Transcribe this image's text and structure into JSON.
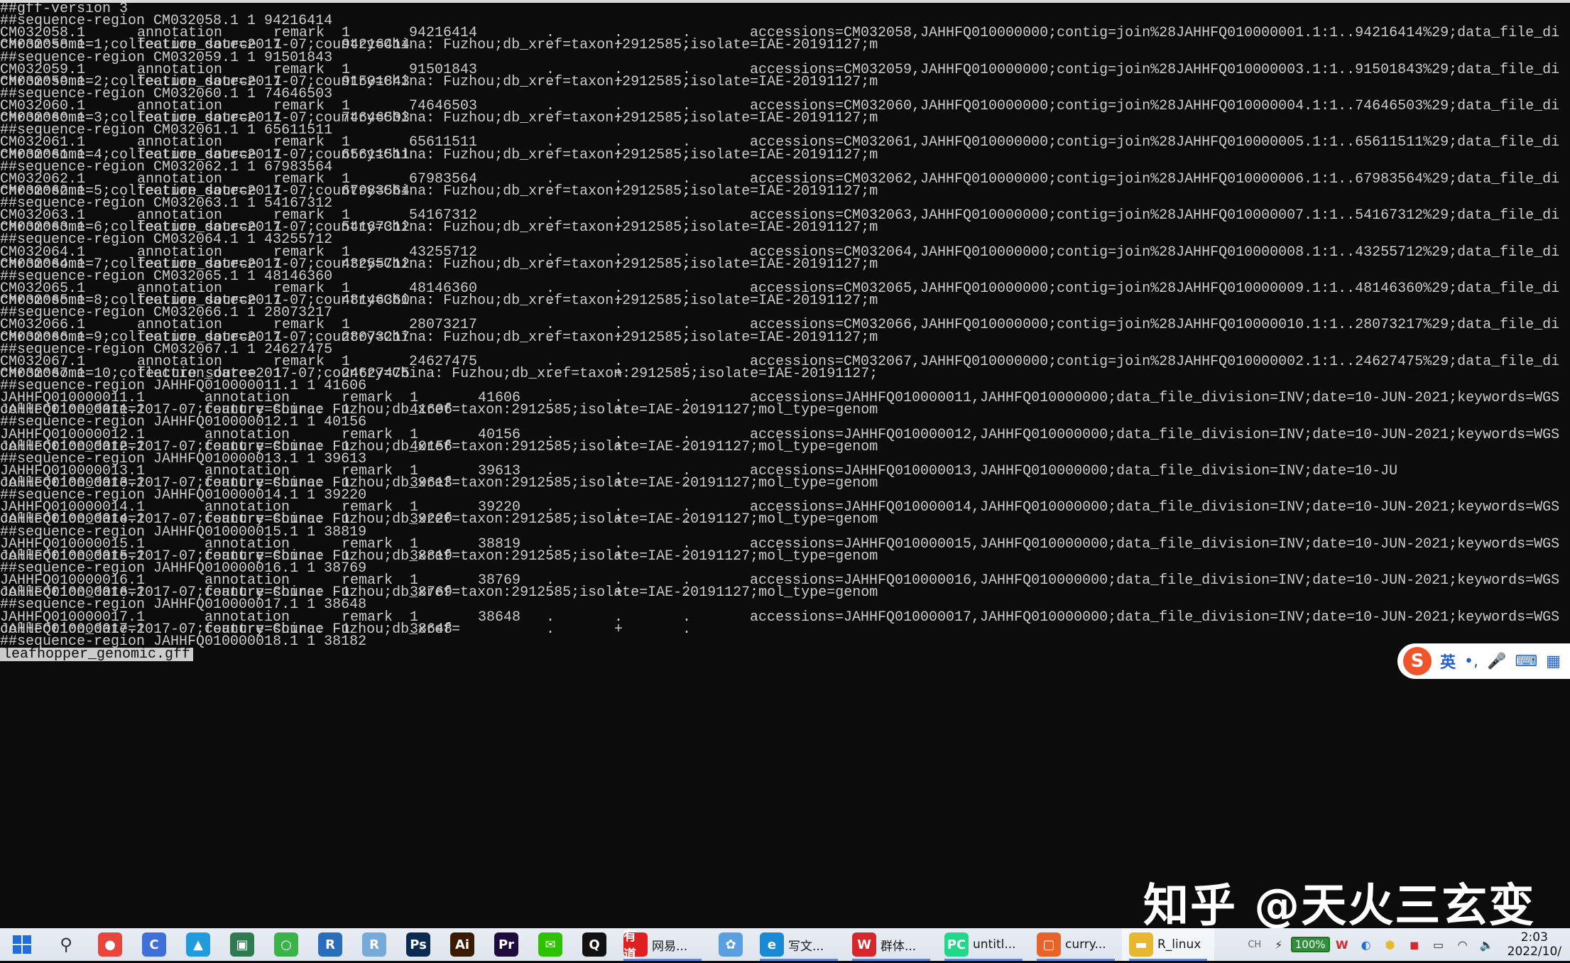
{
  "terminal": {
    "lines": [
      [
        "##gff-version 3"
      ],
      [
        "##sequence-region CM032058.1 1 94216414"
      ],
      [
        "CM032058.1",
        "annotation",
        "remark",
        "1",
        "94216414",
        ".",
        ".",
        ".",
        "accessions=CM032058,JAHHFQ010000000;contig=join%28JAHHFQ010000001.1:1..94216414%29;data_file_di"
      ],
      [
        "CM032058.1",
        "feature source",
        "1",
        "94216414",
        ".",
        "+",
        ".",
        "chromosome=1;collection_date=2017-07;country=China: Fuzhou;db_xref=taxon:2912585;isolate=IAE-20191127;m"
      ],
      [
        "##sequence-region CM032059.1 1 91501843"
      ],
      [
        "CM032059.1",
        "annotation",
        "remark",
        "1",
        "91501843",
        ".",
        ".",
        ".",
        "accessions=CM032059,JAHHFQ010000000;contig=join%28JAHHFQ010000003.1:1..91501843%29;data_file_di"
      ],
      [
        "CM032059.1",
        "feature source",
        "1",
        "91501843",
        ".",
        "+",
        ".",
        "chromosome=2;collection_date=2017-07;country=China: Fuzhou;db_xref=taxon:2912585;isolate=IAE-20191127;m"
      ],
      [
        "##sequence-region CM032060.1 1 74646503"
      ],
      [
        "CM032060.1",
        "annotation",
        "remark",
        "1",
        "74646503",
        ".",
        ".",
        ".",
        "accessions=CM032060,JAHHFQ010000000;contig=join%28JAHHFQ010000004.1:1..74646503%29;data_file_di"
      ],
      [
        "CM032060.1",
        "feature source",
        "1",
        "74646503",
        ".",
        "+",
        ".",
        "chromosome=3;collection_date=2017-07;country=China: Fuzhou;db_xref=taxon:2912585;isolate=IAE-20191127;m"
      ],
      [
        "##sequence-region CM032061.1 1 65611511"
      ],
      [
        "CM032061.1",
        "annotation",
        "remark",
        "1",
        "65611511",
        ".",
        ".",
        ".",
        "accessions=CM032061,JAHHFQ010000000;contig=join%28JAHHFQ010000005.1:1..65611511%29;data_file_di"
      ],
      [
        "CM032061.1",
        "feature source",
        "1",
        "65611511",
        ".",
        "+",
        ".",
        "chromosome=4;collection_date=2017-07;country=China: Fuzhou;db_xref=taxon:2912585;isolate=IAE-20191127;m"
      ],
      [
        "##sequence-region CM032062.1 1 67983564"
      ],
      [
        "CM032062.1",
        "annotation",
        "remark",
        "1",
        "67983564",
        ".",
        ".",
        ".",
        "accessions=CM032062,JAHHFQ010000000;contig=join%28JAHHFQ010000006.1:1..67983564%29;data_file_di"
      ],
      [
        "CM032062.1",
        "feature source",
        "1",
        "67983564",
        ".",
        "+",
        ".",
        "chromosome=5;collection_date=2017-07;country=China: Fuzhou;db_xref=taxon:2912585;isolate=IAE-20191127;m"
      ],
      [
        "##sequence-region CM032063.1 1 54167312"
      ],
      [
        "CM032063.1",
        "annotation",
        "remark",
        "1",
        "54167312",
        ".",
        ".",
        ".",
        "accessions=CM032063,JAHHFQ010000000;contig=join%28JAHHFQ010000007.1:1..54167312%29;data_file_di"
      ],
      [
        "CM032063.1",
        "feature source",
        "1",
        "54167312",
        ".",
        "+",
        ".",
        "chromosome=6;collection_date=2017-07;country=China: Fuzhou;db_xref=taxon:2912585;isolate=IAE-20191127;m"
      ],
      [
        "##sequence-region CM032064.1 1 43255712"
      ],
      [
        "CM032064.1",
        "annotation",
        "remark",
        "1",
        "43255712",
        ".",
        ".",
        ".",
        "accessions=CM032064,JAHHFQ010000000;contig=join%28JAHHFQ010000008.1:1..43255712%29;data_file_di"
      ],
      [
        "CM032064.1",
        "feature source",
        "1",
        "43255712",
        ".",
        "+",
        ".",
        "chromosome=7;collection_date=2017-07;country=China: Fuzhou;db_xref=taxon:2912585;isolate=IAE-20191127;m"
      ],
      [
        "##sequence-region CM032065.1 1 48146360"
      ],
      [
        "CM032065.1",
        "annotation",
        "remark",
        "1",
        "48146360",
        ".",
        ".",
        ".",
        "accessions=CM032065,JAHHFQ010000000;contig=join%28JAHHFQ010000009.1:1..48146360%29;data_file_di"
      ],
      [
        "CM032065.1",
        "feature source",
        "1",
        "48146360",
        ".",
        "+",
        ".",
        "chromosome=8;collection_date=2017-07;country=China: Fuzhou;db_xref=taxon:2912585;isolate=IAE-20191127;m"
      ],
      [
        "##sequence-region CM032066.1 1 28073217"
      ],
      [
        "CM032066.1",
        "annotation",
        "remark",
        "1",
        "28073217",
        ".",
        ".",
        ".",
        "accessions=CM032066,JAHHFQ010000000;contig=join%28JAHHFQ010000010.1:1..28073217%29;data_file_di"
      ],
      [
        "CM032066.1",
        "feature source",
        "1",
        "28073217",
        ".",
        "+",
        ".",
        "chromosome=9;collection_date=2017-07;country=China: Fuzhou;db_xref=taxon:2912585;isolate=IAE-20191127;m"
      ],
      [
        "##sequence-region CM032067.1 1 24627475"
      ],
      [
        "CM032067.1",
        "annotation",
        "remark",
        "1",
        "24627475",
        ".",
        ".",
        ".",
        "accessions=CM032067,JAHHFQ010000000;contig=join%28JAHHFQ010000002.1:1..24627475%29;data_file_di"
      ],
      [
        "CM032067.1",
        "feature source",
        "1",
        "24627475",
        ".",
        "+",
        ".",
        "chromosome=10;collection_date=2017-07;country=China: Fuzhou;db_xref=taxon:2912585;isolate=IAE-20191127;"
      ],
      [
        "##sequence-region JAHHFQ010000011.1 1 41606"
      ],
      [
        "JAHHFQ010000011.1",
        "annotation",
        "remark",
        "1",
        "41606",
        ".",
        ".",
        ".",
        "accessions=JAHHFQ010000011,JAHHFQ010000000;data_file_division=INV;date=10-JUN-2021;keywords=WGS"
      ],
      [
        "JAHHFQ010000011.1",
        "feature source",
        "1",
        "41606",
        ".",
        "+",
        ".",
        "collection_date=2017-07;country=China: Fuzhou;db_xref=taxon:2912585;isolate=IAE-20191127;mol_type=genom"
      ],
      [
        "##sequence-region JAHHFQ010000012.1 1 40156"
      ],
      [
        "JAHHFQ010000012.1",
        "annotation",
        "remark",
        "1",
        "40156",
        ".",
        ".",
        ".",
        "accessions=JAHHFQ010000012,JAHHFQ010000000;data_file_division=INV;date=10-JUN-2021;keywords=WGS"
      ],
      [
        "JAHHFQ010000012.1",
        "feature source",
        "1",
        "40156",
        ".",
        "+",
        ".",
        "collection_date=2017-07;country=China: Fuzhou;db_xref=taxon:2912585;isolate=IAE-20191127;mol_type=genom"
      ],
      [
        "##sequence-region JAHHFQ010000013.1 1 39613"
      ],
      [
        "JAHHFQ010000013.1",
        "annotation",
        "remark",
        "1",
        "39613",
        ".",
        ".",
        ".",
        "accessions=JAHHFQ010000013,JAHHFQ010000000;data_file_division=INV;date=10-JU"
      ],
      [
        "JAHHFQ010000013.1",
        "feature source",
        "1",
        "39613",
        ".",
        "+",
        ".",
        "collection_date=2017-07;country=China: Fuzhou;db_xref=taxon:2912585;isolate=IAE-20191127;mol_type=genom"
      ],
      [
        "##sequence-region JAHHFQ010000014.1 1 39220"
      ],
      [
        "JAHHFQ010000014.1",
        "annotation",
        "remark",
        "1",
        "39220",
        ".",
        ".",
        ".",
        "accessions=JAHHFQ010000014,JAHHFQ010000000;data_file_division=INV;date=10-JUN-2021;keywords=WGS"
      ],
      [
        "JAHHFQ010000014.1",
        "feature source",
        "1",
        "39220",
        ".",
        "+",
        ".",
        "collection_date=2017-07;country=China: Fuzhou;db_xref=taxon:2912585;isolate=IAE-20191127;mol_type=genom"
      ],
      [
        "##sequence-region JAHHFQ010000015.1 1 38819"
      ],
      [
        "JAHHFQ010000015.1",
        "annotation",
        "remark",
        "1",
        "38819",
        ".",
        ".",
        ".",
        "accessions=JAHHFQ010000015,JAHHFQ010000000;data_file_division=INV;date=10-JUN-2021;keywords=WGS"
      ],
      [
        "JAHHFQ010000015.1",
        "feature source",
        "1",
        "38819",
        ".",
        "+",
        ".",
        "collection_date=2017-07;country=China: Fuzhou;db_xref=taxon:2912585;isolate=IAE-20191127;mol_type=genom"
      ],
      [
        "##sequence-region JAHHFQ010000016.1 1 38769"
      ],
      [
        "JAHHFQ010000016.1",
        "annotation",
        "remark",
        "1",
        "38769",
        ".",
        ".",
        ".",
        "accessions=JAHHFQ010000016,JAHHFQ010000000;data_file_division=INV;date=10-JUN-2021;keywords=WGS"
      ],
      [
        "JAHHFQ010000016.1",
        "feature source",
        "1",
        "38769",
        ".",
        "+",
        ".",
        "collection_date=2017-07;country=China: Fuzhou;db_xref=taxon:2912585;isolate=IAE-20191127;mol_type=genom"
      ],
      [
        "##sequence-region JAHHFQ010000017.1 1 38648"
      ],
      [
        "JAHHFQ010000017.1",
        "annotation",
        "remark",
        "1",
        "38648",
        ".",
        ".",
        ".",
        "accessions=JAHHFQ010000017,JAHHFQ010000000;data_file_division=INV;date=10-JUN-2021;keywords=WGS"
      ],
      [
        "JAHHFQ010000017.1",
        "feature source",
        "1",
        "38648",
        ".",
        "+",
        ".",
        "collection_date=2017-07;country=China: Fuzhou;db_xref="
      ],
      [
        "##sequence-region JAHHFQ010000018.1 1 38182"
      ]
    ],
    "status": "leafhopper_genomic.gff"
  },
  "ime": {
    "logo": "S",
    "mode": "英",
    "punct": "•,",
    "mic": "🎤",
    "keyboard": "⌨",
    "grid": "▦"
  },
  "watermark": "知乎 @天火三玄变",
  "taskbar": {
    "items": [
      {
        "name": "windows-start-button",
        "label": "",
        "icon": "windows-logo",
        "color": "#1f6fd6"
      },
      {
        "name": "search-button",
        "label": "",
        "icon": "search-icon",
        "color": "#333333"
      },
      {
        "name": "taskbar-chrome",
        "label": "",
        "icon": "chrome-icon",
        "color": "#e8453c"
      },
      {
        "name": "taskbar-app-blue",
        "label": "",
        "icon": "circle-app-icon",
        "color": "#3f6fd8"
      },
      {
        "name": "taskbar-photos",
        "label": "",
        "icon": "photos-icon",
        "color": "#1f9bde"
      },
      {
        "name": "taskbar-app-green-window",
        "label": "",
        "icon": "window-app-icon",
        "color": "#2f7a4f"
      },
      {
        "name": "taskbar-app-green-circle",
        "label": "",
        "icon": "ring-app-icon",
        "color": "#3cb34a"
      },
      {
        "name": "taskbar-r",
        "label": "",
        "icon": "r-icon",
        "color": "#2a6ebb"
      },
      {
        "name": "taskbar-rstudio",
        "label": "",
        "icon": "rstudio-icon",
        "color": "#75aadb"
      },
      {
        "name": "taskbar-photoshop",
        "label": "",
        "icon": "photoshop-icon",
        "color": "#0b2a52"
      },
      {
        "name": "taskbar-illustrator",
        "label": "",
        "icon": "illustrator-icon",
        "color": "#3a1b00"
      },
      {
        "name": "taskbar-premiere",
        "label": "",
        "icon": "premiere-icon",
        "color": "#1e0a3c"
      },
      {
        "name": "taskbar-wechat",
        "label": "",
        "icon": "wechat-icon",
        "color": "#2dc100"
      },
      {
        "name": "taskbar-qq",
        "label": "",
        "icon": "qq-icon",
        "color": "#111111"
      },
      {
        "name": "taskbar-youdao",
        "label": "网易...",
        "icon": "youdao-icon",
        "color": "#e02020"
      },
      {
        "name": "taskbar-app-fan",
        "label": "",
        "icon": "fan-app-icon",
        "color": "#5aa0e0"
      },
      {
        "name": "taskbar-edge",
        "label": "写文...",
        "icon": "edge-icon",
        "color": "#1a8ad4"
      },
      {
        "name": "taskbar-wps",
        "label": "群体...",
        "icon": "wps-icon",
        "color": "#d4282d"
      },
      {
        "name": "taskbar-pycharm",
        "label": "untitl...",
        "icon": "pycharm-icon",
        "color": "#21d789"
      },
      {
        "name": "taskbar-curry",
        "label": "curry...",
        "icon": "app-window-icon",
        "color": "#e8632a"
      },
      {
        "name": "taskbar-rlinux",
        "label": "R_linux",
        "icon": "folder-icon",
        "color": "#e8b730"
      }
    ],
    "glyphs": {
      "chrome-icon": "●",
      "circle-app-icon": "C",
      "photos-icon": "▲",
      "window-app-icon": "▣",
      "ring-app-icon": "○",
      "r-icon": "R",
      "rstudio-icon": "R",
      "photoshop-icon": "Ps",
      "illustrator-icon": "Ai",
      "premiere-icon": "Pr",
      "wechat-icon": "✉",
      "qq-icon": "Q",
      "youdao-icon": "有道",
      "fan-app-icon": "✿",
      "edge-icon": "e",
      "wps-icon": "W",
      "pycharm-icon": "PC",
      "app-window-icon": "▢",
      "folder-icon": "▬",
      "search-icon": "⚲"
    },
    "tray": {
      "ch": "CH",
      "battery": "100%",
      "time": "2:03",
      "date": "2022/10/"
    }
  }
}
